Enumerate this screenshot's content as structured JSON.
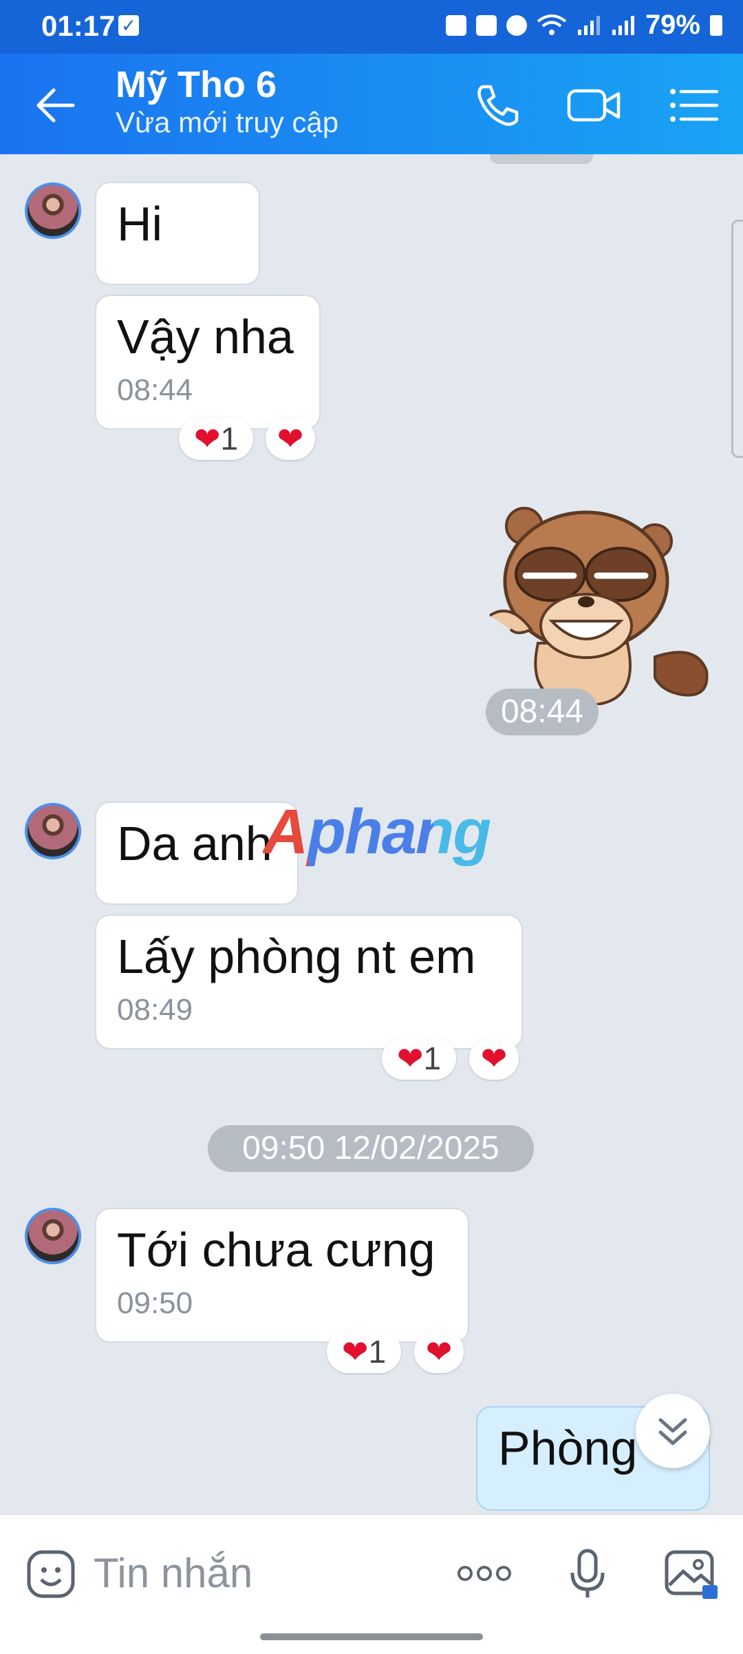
{
  "status_bar": {
    "time": "01:17",
    "battery": "79%"
  },
  "header": {
    "title": "Mỹ Tho 6",
    "subtitle": "Vừa mới truy cập"
  },
  "messages": [
    {
      "text": "Hi"
    },
    {
      "text": "Vậy nha",
      "time": "08:44",
      "reaction_count": "1"
    },
    {
      "sticker": "raccoon-sticker",
      "time": "08:44"
    },
    {
      "text": "Da anh"
    },
    {
      "text": "Lấy phòng nt em",
      "time": "08:49",
      "reaction_count": "1"
    },
    {
      "date_separator": "09:50 12/02/2025"
    },
    {
      "text": "Tới chưa cưng",
      "time": "09:50",
      "reaction_count": "1"
    },
    {
      "text": "Phòng 6",
      "outgoing": true
    }
  ],
  "watermark": "Aphang",
  "input": {
    "placeholder": "Tin nhắn"
  },
  "colors": {
    "header_start": "#1a73f0",
    "header_end": "#19a4f5",
    "heart": "#e0102e",
    "outgoing_bubble": "#d6efff"
  }
}
